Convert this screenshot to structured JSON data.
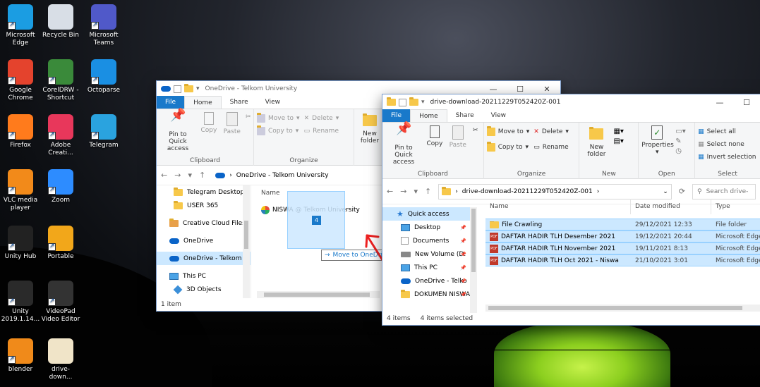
{
  "desktop": {
    "icons": [
      {
        "label": "Microsoft\nEdge",
        "icon": "edge-icon",
        "color": "#1b9de2"
      },
      {
        "label": "Recycle Bin",
        "icon": "recycle-bin-icon",
        "color": "#d8dee6"
      },
      {
        "label": "Microsoft\nTeams",
        "icon": "teams-icon",
        "color": "#5059c9"
      },
      {
        "label": "Google\nChrome",
        "icon": "chrome-icon",
        "color": "#e4432d"
      },
      {
        "label": "CorelDRW -\nShortcut",
        "icon": "coreldraw-icon",
        "color": "#3a8a3a"
      },
      {
        "label": "Octoparse",
        "icon": "octoparse-icon",
        "color": "#1a8fe3"
      },
      {
        "label": "Firefox",
        "icon": "firefox-icon",
        "color": "#ff7b1c"
      },
      {
        "label": "Adobe\nCreati...",
        "icon": "adobe-cc-icon",
        "color": "#e8375b"
      },
      {
        "label": "Telegram",
        "icon": "telegram-icon",
        "color": "#2aa3df"
      },
      {
        "label": "VLC media\nplayer",
        "icon": "vlc-icon",
        "color": "#f28a1a"
      },
      {
        "label": "Zoom",
        "icon": "zoom-icon",
        "color": "#2d8cff"
      },
      {
        "label": "Unity Hub",
        "icon": "unity-hub-icon",
        "color": "#222222"
      },
      {
        "label": "Portable",
        "icon": "portable-icon",
        "color": "#f2a71a"
      },
      {
        "label": "Unity\n2019.1.14...",
        "icon": "unity-icon",
        "color": "#2a2a2a"
      },
      {
        "label": "VideoPad\nVideo Editor",
        "icon": "videopad-icon",
        "color": "#333333"
      },
      {
        "label": "blender",
        "icon": "blender-icon",
        "color": "#f08a1a"
      },
      {
        "label": "drive-down...",
        "icon": "pdf-file-icon",
        "color": "#f0e4c8"
      }
    ]
  },
  "win1": {
    "title": "OneDrive - Telkom University",
    "tabs": [
      "File",
      "Home",
      "Share",
      "View"
    ],
    "ribbon": {
      "pin": "Pin to Quick\naccess",
      "copy": "Copy",
      "paste": "Paste",
      "clipboard": "Clipboard",
      "move_to": "Move to",
      "copy_to": "Copy to",
      "delete": "Delete",
      "rename": "Rename",
      "organize": "Organize",
      "new_folder": "New\nfolder"
    },
    "address": "OneDrive - Telkom University",
    "nav": [
      "Telegram Desktop",
      "USER 365",
      "Creative Cloud Files",
      "OneDrive",
      "OneDrive - Telkom U",
      "This PC",
      "3D Objects"
    ],
    "col_name": "Name",
    "file": "NISWA @ Telkom University",
    "status": "1 item"
  },
  "drag": {
    "count": "4",
    "tooltip": "Move to OneDrive - Telkom University"
  },
  "win2": {
    "title": "drive-download-20211229T052420Z-001",
    "tabs": [
      "File",
      "Home",
      "Share",
      "View"
    ],
    "ribbon": {
      "pin": "Pin to Quick\naccess",
      "copy": "Copy",
      "paste": "Paste",
      "clipboard": "Clipboard",
      "move_to": "Move to",
      "copy_to": "Copy to",
      "delete": "Delete",
      "rename": "Rename",
      "organize": "Organize",
      "new_folder": "New\nfolder",
      "new": "New",
      "properties": "Properties",
      "open": "Open",
      "select_all": "Select all",
      "select_none": "Select none",
      "invert": "Invert selection",
      "select": "Select"
    },
    "address": "drive-download-20211229T052420Z-001",
    "search_placeholder": "Search drive-",
    "nav": [
      {
        "label": "Quick access",
        "icon": "star-icon"
      },
      {
        "label": "Desktop",
        "icon": "desktop-icon"
      },
      {
        "label": "Documents",
        "icon": "documents-icon"
      },
      {
        "label": "New Volume (D:",
        "icon": "drive-icon"
      },
      {
        "label": "This PC",
        "icon": "pc-icon"
      },
      {
        "label": "OneDrive - Telko",
        "icon": "onedrive-icon"
      },
      {
        "label": "DOKUMEN NISWA",
        "icon": "folder-icon"
      }
    ],
    "columns": [
      "Name",
      "Date modified",
      "Type"
    ],
    "files": [
      {
        "name": "File Crawling",
        "date": "29/12/2021 12:33",
        "type": "File folder",
        "kind": "folder"
      },
      {
        "name": "DAFTAR HADIR TLH Desember 2021",
        "date": "19/12/2021 20:44",
        "type": "Microsoft Edge",
        "kind": "pdf"
      },
      {
        "name": "DAFTAR HADIR TLH November 2021",
        "date": "19/11/2021 8:13",
        "type": "Microsoft Edge",
        "kind": "pdf"
      },
      {
        "name": "DAFTAR HADIR TLH Oct 2021 - Niswa",
        "date": "21/10/2021 3:01",
        "type": "Microsoft Edge",
        "kind": "pdf"
      }
    ],
    "status_items": "4 items",
    "status_selected": "4 items selected"
  }
}
